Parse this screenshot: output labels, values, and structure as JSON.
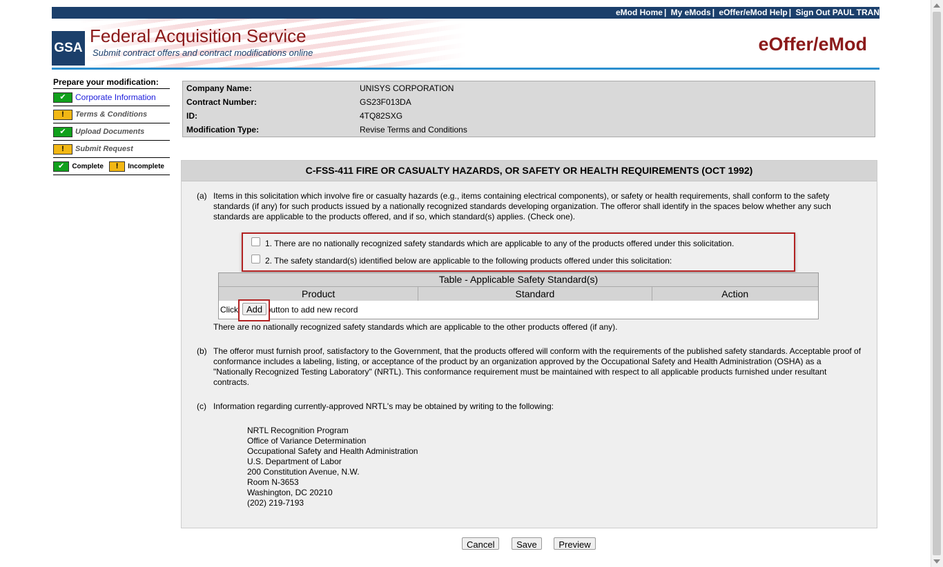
{
  "topnav": {
    "links": [
      "eMod Home",
      "My eMods",
      "eOffer/eMod Help",
      "Sign Out PAUL TRAN"
    ]
  },
  "banner": {
    "logo": "GSA",
    "title": "Federal Acquisition Service",
    "subtitle": "Submit contract offers and contract modifications online",
    "app_name": "eOffer/eMod"
  },
  "sidebar": {
    "title": "Prepare your modification:",
    "items": [
      {
        "label": "Corporate Information",
        "status": "complete",
        "icon": "check-icon"
      },
      {
        "label": "Terms & Conditions",
        "status": "incomplete",
        "icon": "exclamation-icon"
      },
      {
        "label": "Upload Documents",
        "status": "complete",
        "icon": "check-icon"
      },
      {
        "label": "Submit Request",
        "status": "incomplete",
        "icon": "exclamation-icon"
      }
    ],
    "legend": {
      "complete": "Complete",
      "incomplete": "Incomplete"
    }
  },
  "info": {
    "company_label": "Company Name:",
    "company_value": "UNISYS CORPORATION",
    "contract_label": "Contract Number:",
    "contract_value": "GS23F013DA",
    "id_label": "ID:",
    "id_value": "4TQ82SXG",
    "modtype_label": "Modification Type:",
    "modtype_value": "Revise Terms and Conditions"
  },
  "clause": {
    "title": "C-FSS-411 FIRE OR CASUALTY HAZARDS, OR SAFETY OR HEALTH REQUIREMENTS (OCT 1992)",
    "a_marker": "(a)",
    "a_text": "Items in this solicitation which involve fire or casualty hazards (e.g., items containing electrical components), or safety or health requirements, shall conform to the safety standards (if any) for such products issued by a nationally recognized standards developing organization. The offeror shall identify in the spaces below whether any such standards are applicable to the products offered, and if so, which standard(s) applies. (Check one).",
    "option1": "1. There are no nationally recognized safety standards which are applicable to any of the products offered under this solicitation.",
    "option2": "2. The safety standard(s) identified below are applicable to the following products offered under this solicitation:",
    "table": {
      "caption": "Table - Applicable Safety Standard(s)",
      "columns": [
        "Product",
        "Standard",
        "Action"
      ],
      "add_prefix": "Click",
      "add_button": "Add",
      "add_suffix": "button to add new record"
    },
    "note": "There are no nationally recognized safety standards which are applicable to the other products offered (if any).",
    "b_marker": "(b)",
    "b_text": "The offeror must furnish proof, satisfactory to the Government, that the products offered will conform with the requirements of the published safety standards. Acceptable proof of conformance includes a labeling, listing, or acceptance of the product by an organization approved by the Occupational Safety and Health Administration (OSHA) as a \"Nationally Recognized Testing Laboratory\" (NRTL). This conformance requirement must be maintained with respect to all applicable products furnished under resultant contracts.",
    "c_marker": "(c)",
    "c_text": "Information regarding currently-approved NRTL's may be obtained by writing to the following:",
    "address": [
      "NRTL Recognition Program",
      "Office of Variance Determination",
      "Occupational Safety and Health Administration",
      "U.S. Department of Labor",
      "200 Constitution Avenue, N.W.",
      "Room N-3653",
      "Washington, DC 20210",
      "(202) 219-7193"
    ]
  },
  "buttons": {
    "cancel": "Cancel",
    "save": "Save",
    "preview": "Preview"
  },
  "colors": {
    "navy": "#1b3f6b",
    "brand_red": "#8b1a1a",
    "complete": "#11a01c",
    "incomplete": "#f2b714",
    "highlight": "#b22222"
  }
}
